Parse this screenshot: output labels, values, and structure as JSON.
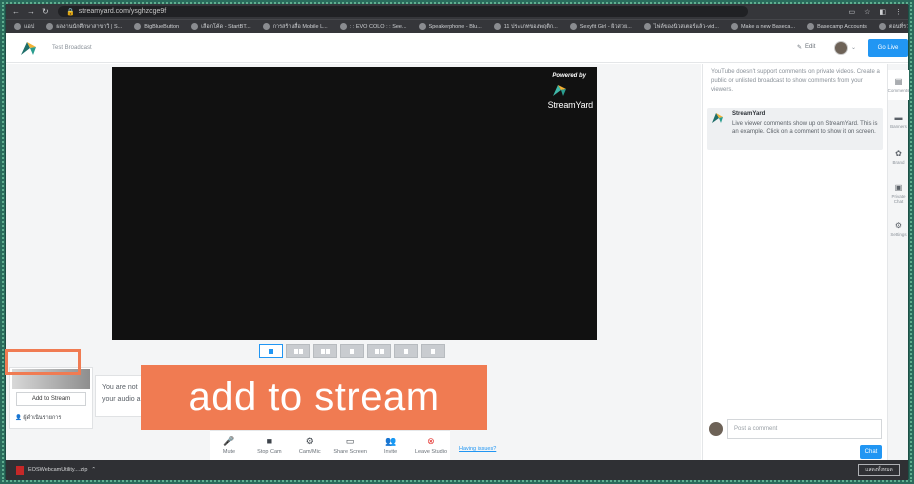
{
  "browser": {
    "url": "streamyard.com/ysghzcge9f",
    "bookmarks": [
      "แอป",
      "ผลงานนักศึกษาสาขาวิ | S...",
      "BigBlueButton",
      "เลือกโค้ด - StartBT...",
      "การสร้างสื่อ Mobile L...",
      ": : EVO COLO : : See...",
      "Speakerphone - Blu...",
      "11 ประเภทของพฤติก...",
      "Sexyfit Girl - ผิวสวย...",
      "ไฟล์ของนิวสเตอร์แล้ว-vid...",
      "Make a new Baseca...",
      "Basecamp Accounts",
      "ตอนที่รวบรวม After Eff..."
    ]
  },
  "header": {
    "broadcast_title": "Test Broadcast",
    "edit_label": "Edit",
    "go_live_label": "Go Live"
  },
  "stage": {
    "powered_by": "Powered by",
    "brand": "StreamYard"
  },
  "participant": {
    "add_button": "Add to Stream",
    "name": "ผู้ดำเนินรายการ"
  },
  "hint": {
    "text": "You are not your audio a"
  },
  "callout": {
    "text": "add to stream"
  },
  "controls": [
    {
      "icon": "mic-icon",
      "glyph": "🎙",
      "label": "Mute"
    },
    {
      "icon": "camera-icon",
      "glyph": "■",
      "label": "Stop Cam"
    },
    {
      "icon": "gear-icon",
      "glyph": "⚙",
      "label": "Cam/Mic"
    },
    {
      "icon": "screen-icon",
      "glyph": "▭",
      "label": "Share Screen"
    },
    {
      "icon": "add-person-icon",
      "glyph": "👥",
      "label": "Invite"
    },
    {
      "icon": "leave-icon",
      "glyph": "⊗",
      "label": "Leave Studio"
    }
  ],
  "having_issues": "Having issues?",
  "comments": {
    "notice": "YouTube doesn't support comments on private videos. Create a public or unlisted broadcast to show comments from your viewers.",
    "sample_author": "StreamYard",
    "sample_message": "Live viewer comments show up on StreamYard. This is an example. Click on a comment to show it on screen.",
    "input_placeholder": "Post a comment",
    "chat_label": "Chat"
  },
  "side_tabs": [
    {
      "icon": "comments-icon",
      "label": "Comments"
    },
    {
      "icon": "banners-icon",
      "label": "Banners"
    },
    {
      "icon": "brand-icon",
      "label": "Brand"
    },
    {
      "icon": "private-chat-icon",
      "label": "Private Chat"
    },
    {
      "icon": "settings-icon",
      "label": "Settings"
    }
  ],
  "download": {
    "file": "EOSWebcamUtility....zip",
    "show_all": "แสดงทั้งหมด"
  },
  "colors": {
    "accent": "#2196f3",
    "callout": "#f07b52",
    "stage_bg": "#111111"
  }
}
